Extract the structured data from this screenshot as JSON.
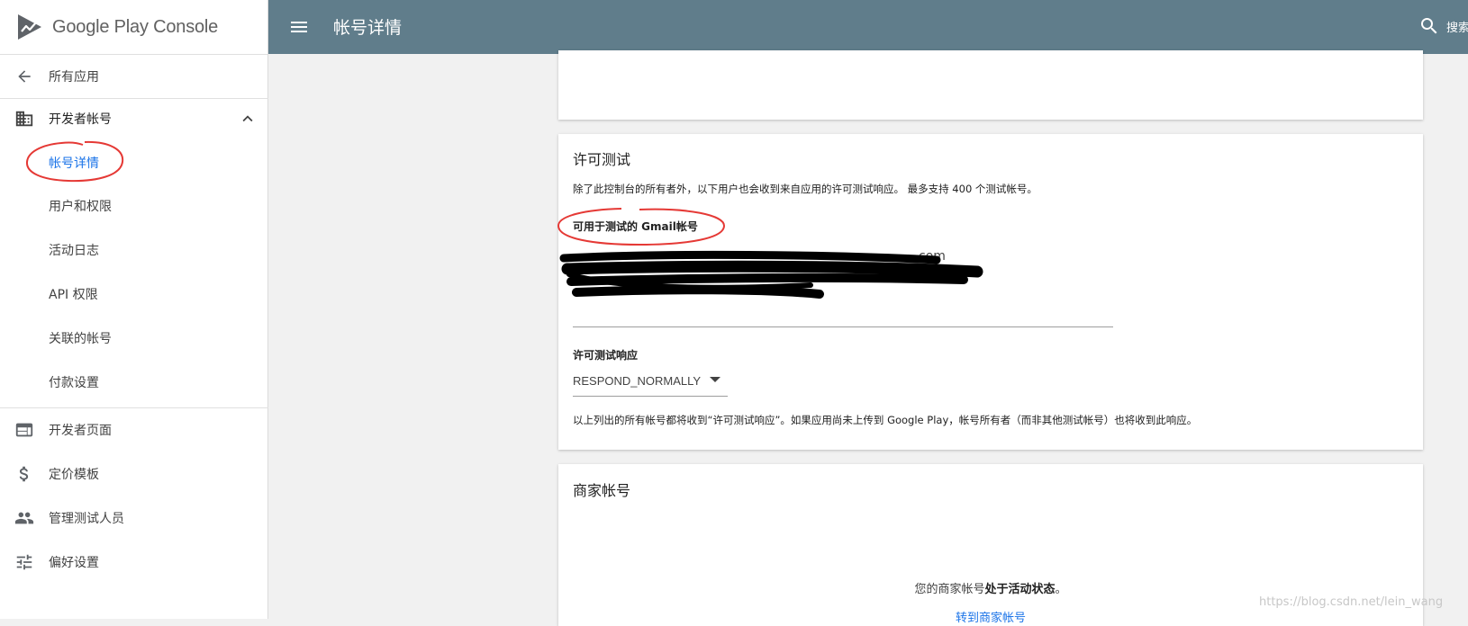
{
  "sidebar": {
    "logo_text": "Google Play Console",
    "back_label": "所有应用",
    "developer_account_label": "开发者帐号",
    "items": [
      {
        "label": "帐号详情",
        "active": true
      },
      {
        "label": "用户和权限"
      },
      {
        "label": "活动日志"
      },
      {
        "label": "API 权限"
      },
      {
        "label": "关联的帐号"
      },
      {
        "label": "付款设置"
      }
    ],
    "bottom_items": [
      {
        "label": "开发者页面",
        "icon": "web-page-icon"
      },
      {
        "label": "定价模板",
        "icon": "dollar-icon"
      },
      {
        "label": "管理测试人员",
        "icon": "people-icon"
      },
      {
        "label": "偏好设置",
        "icon": "tune-sliders-icon"
      }
    ]
  },
  "topbar": {
    "title": "帐号详情",
    "search_label": "搜索"
  },
  "license_card": {
    "title": "许可测试",
    "description": "除了此控制台的所有者外，以下用户也会收到来自应用的许可测试响应。 最多支持 400 个测试帐号。",
    "gmail_label": "可用于测试的 Gmail帐号",
    "email_fragment": "com",
    "response_label": "许可测试响应",
    "response_value": "RESPOND_NORMALLY",
    "footnote": "以上列出的所有帐号都将收到“许可测试响应”。如果应用尚未上传到 Google Play，帐号所有者（而非其他测试帐号）也将收到此响应。"
  },
  "merchant_card": {
    "title": "商家帐号",
    "status_prefix": "您的商家帐号",
    "status_bold": "处于活动状态",
    "status_suffix": "。",
    "link_label": "转到商家帐号"
  },
  "watermark": "https://blog.csdn.net/lein_wang",
  "colors": {
    "topbar": "#607d8b",
    "accent": "#1a73e8",
    "annotation": "#e53935"
  }
}
